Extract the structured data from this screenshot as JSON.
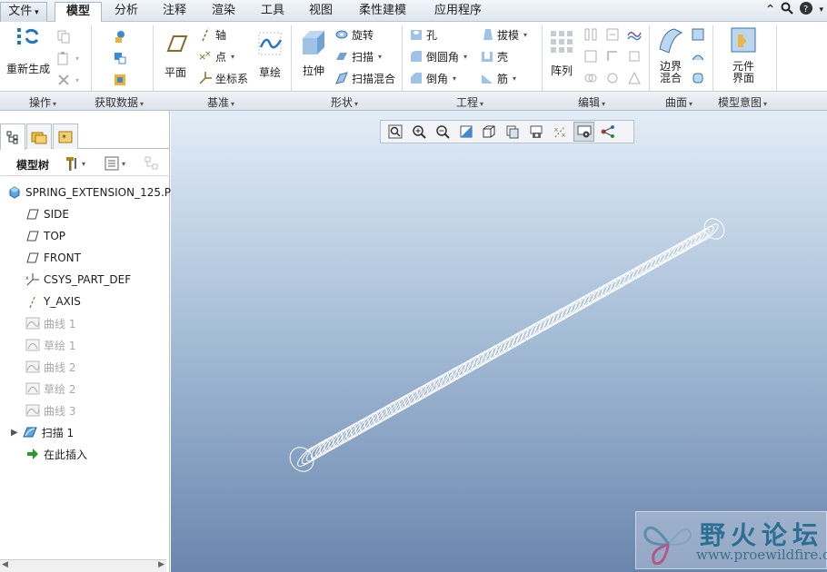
{
  "tabs": {
    "file": "文件",
    "items": [
      "模型",
      "分析",
      "注释",
      "渲染",
      "工具",
      "视图",
      "柔性建模",
      "应用程序"
    ],
    "active": "模型"
  },
  "ribbon": {
    "operations": {
      "regenerate": "重新生成",
      "group": "操作"
    },
    "get_data": {
      "group": "获取数据"
    },
    "datum": {
      "plane": "平面",
      "axis": "轴",
      "point": "点",
      "csys": "坐标系",
      "sketch": "草绘",
      "group": "基准"
    },
    "shapes": {
      "extrude": "拉伸",
      "revolve": "旋转",
      "sweep": "扫描",
      "swept_blend": "扫描混合",
      "group": "形状"
    },
    "engineering": {
      "hole": "孔",
      "round": "倒圆角",
      "chamfer": "倒角",
      "draft": "拔模",
      "shell": "壳",
      "rib": "筋",
      "group": "工程"
    },
    "editing": {
      "pattern": "阵列",
      "group": "编辑"
    },
    "surfaces": {
      "boundary_blend_1": "边界",
      "boundary_blend_2": "混合",
      "group": "曲面"
    },
    "model_intent": {
      "component_1": "元件",
      "component_2": "界面",
      "group": "模型意图"
    }
  },
  "panel": {
    "tree_label": "模型树",
    "nodes": [
      {
        "label": "SPRING_EXTENSION_125.P",
        "icon": "part-icon",
        "dim": false
      },
      {
        "label": "SIDE",
        "icon": "datum-plane-icon",
        "dim": false
      },
      {
        "label": "TOP",
        "icon": "datum-plane-icon",
        "dim": false
      },
      {
        "label": "FRONT",
        "icon": "datum-plane-icon",
        "dim": false
      },
      {
        "label": "CSYS_PART_DEF",
        "icon": "csys-icon",
        "dim": false
      },
      {
        "label": "Y_AXIS",
        "icon": "axis-icon",
        "dim": false
      },
      {
        "label": "曲线 1",
        "icon": "curve-icon",
        "dim": true
      },
      {
        "label": "草绘 1",
        "icon": "sketch-icon",
        "dim": true
      },
      {
        "label": "曲线 2",
        "icon": "curve-icon",
        "dim": true
      },
      {
        "label": "草绘 2",
        "icon": "sketch-icon",
        "dim": true
      },
      {
        "label": "曲线 3",
        "icon": "curve-icon",
        "dim": true
      },
      {
        "label": "扫描 1",
        "icon": "sweep-icon",
        "dim": false
      },
      {
        "label": "在此插入",
        "icon": "insert-here-icon",
        "dim": false
      }
    ]
  },
  "watermark": {
    "title": "野火论坛",
    "url": "www.proewildfire.cn"
  },
  "colors": {
    "accent": "#2b6f93",
    "viewport_top": "#e3edf7",
    "viewport_bottom": "#6a86ae"
  }
}
